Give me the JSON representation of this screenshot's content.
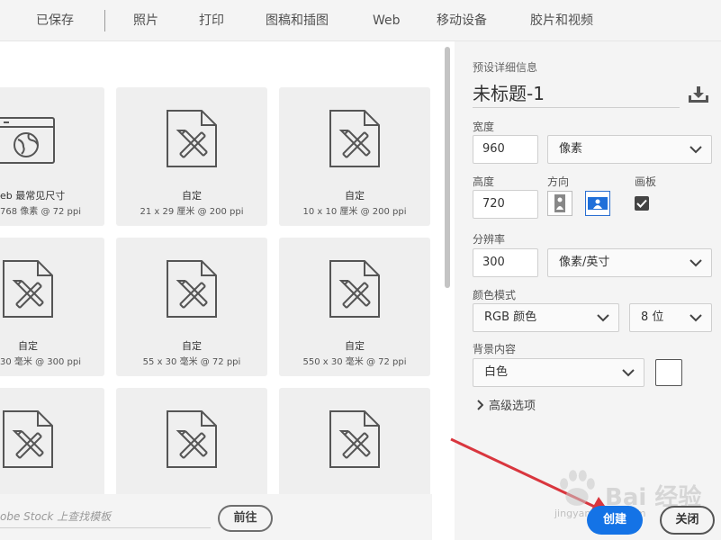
{
  "tabs": [
    {
      "label": "已保存"
    },
    {
      "label": "照片"
    },
    {
      "label": "打印"
    },
    {
      "label": "图稿和插图"
    },
    {
      "label": "Web"
    },
    {
      "label": "移动设备"
    },
    {
      "label": "胶片和视频"
    }
  ],
  "presets": [
    {
      "icon": "web-browser-icon",
      "title": "eb 最常见尺寸",
      "subtitle": "768 像素 @ 72 ppi"
    },
    {
      "icon": "document-pencil-icon",
      "title": "自定",
      "subtitle": "21 x 29 厘米 @ 200 ppi"
    },
    {
      "icon": "document-pencil-icon",
      "title": "自定",
      "subtitle": "10 x 10 厘米 @ 200 ppi"
    },
    {
      "icon": "document-pencil-icon",
      "title": "自定",
      "subtitle": "30 毫米 @ 300 ppi"
    },
    {
      "icon": "document-pencil-icon",
      "title": "自定",
      "subtitle": "55 x 30 毫米 @ 72 ppi"
    },
    {
      "icon": "document-pencil-icon",
      "title": "自定",
      "subtitle": "550 x 30 毫米 @ 72 ppi"
    },
    {
      "icon": "document-pencil-icon",
      "title": "",
      "subtitle": ""
    },
    {
      "icon": "document-pencil-icon",
      "title": "",
      "subtitle": ""
    },
    {
      "icon": "document-pencil-icon",
      "title": "",
      "subtitle": ""
    }
  ],
  "stock": {
    "placeholder": "obe Stock 上查找模板",
    "go_label": "前往"
  },
  "details": {
    "header": "预设详细信息",
    "doc_title": "未标题-1",
    "width_label": "宽度",
    "width_value": "960",
    "width_unit": "像素",
    "height_label": "高度",
    "height_value": "720",
    "orientation_label": "方向",
    "artboard_label": "画板",
    "artboard_checked": true,
    "resolution_label": "分辨率",
    "resolution_value": "300",
    "resolution_unit": "像素/英寸",
    "color_mode_label": "颜色模式",
    "color_mode_value": "RGB 颜色",
    "bit_depth_value": "8 位",
    "background_label": "背景内容",
    "background_value": "白色",
    "background_swatch": "#ffffff",
    "advanced_label": "高级选项"
  },
  "actions": {
    "create_label": "创建",
    "close_label": "关闭"
  },
  "watermark": {
    "brand": "Bai 经验",
    "url": "jingyan.baidu.com"
  },
  "colors": {
    "accent": "#1473e6",
    "panel_bg": "#f4f4f4",
    "card_bg": "#efefef",
    "annotation_arrow": "#d9363e"
  }
}
